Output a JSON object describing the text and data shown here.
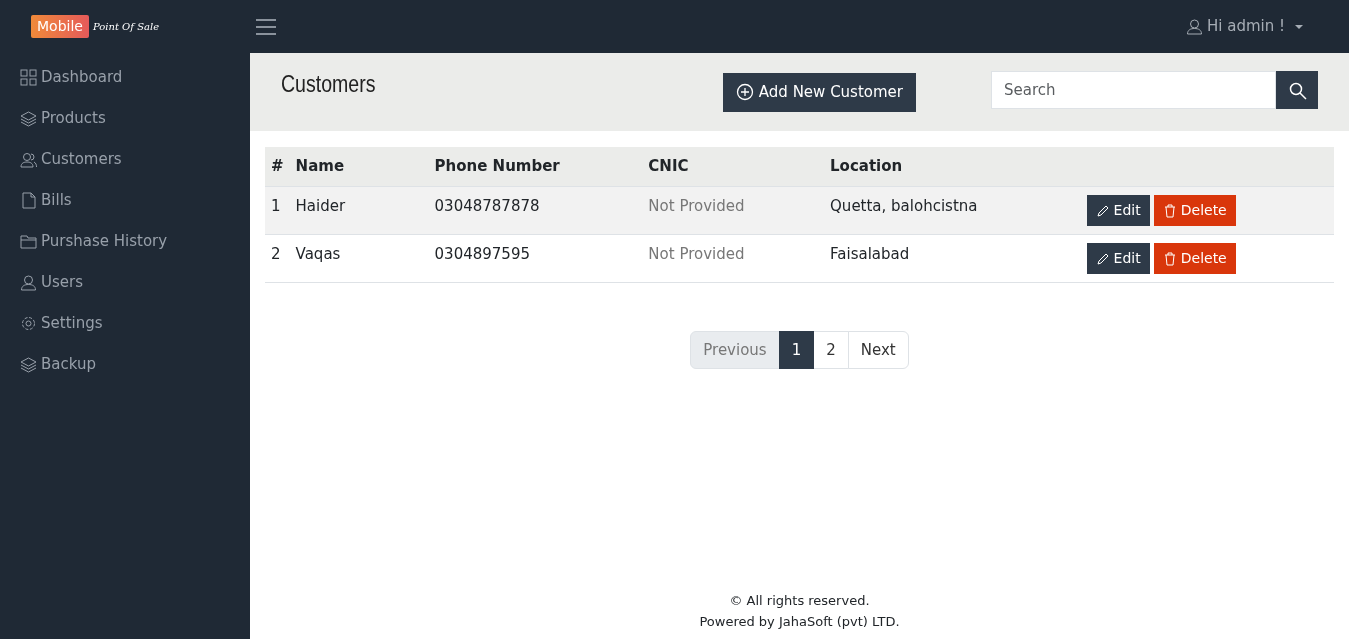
{
  "brand": {
    "badge": "Mobile",
    "tagline": "Point Of Sale"
  },
  "user_menu": {
    "label": "Hi admin !"
  },
  "sidebar": {
    "items": [
      {
        "label": "Dashboard"
      },
      {
        "label": "Products"
      },
      {
        "label": "Customers"
      },
      {
        "label": "Bills"
      },
      {
        "label": "Purshase History"
      },
      {
        "label": "Users"
      },
      {
        "label": "Settings"
      },
      {
        "label": "Backup"
      }
    ]
  },
  "page": {
    "title": "Customers",
    "add_button": "Add New Customer",
    "search": {
      "placeholder": "Search"
    }
  },
  "table": {
    "columns": [
      "#",
      "Name",
      "Phone Number",
      "CNIC",
      "Location"
    ],
    "rows": [
      {
        "cells": [
          "1",
          "Haider",
          "03048787878",
          "Not Provided",
          "Quetta, balohcistna"
        ],
        "highlighted": true,
        "actions": [
          "Edit",
          "Delete"
        ]
      },
      {
        "cells": [
          "2",
          "Vaqas",
          "0304897595",
          "Not Provided",
          "Faisalabad"
        ],
        "highlighted": false,
        "actions": [
          "Edit",
          "Delete"
        ]
      }
    ]
  },
  "pagination": [
    {
      "label": "Previous",
      "selected": false,
      "disabled": true
    },
    {
      "label": "1",
      "selected": true,
      "disabled": false
    },
    {
      "label": "2",
      "selected": false,
      "disabled": false
    },
    {
      "label": "Next",
      "selected": false,
      "disabled": false
    }
  ],
  "footer": [
    "© All rights reserved.",
    "Powered by JahaSoft (pvt) LTD."
  ]
}
